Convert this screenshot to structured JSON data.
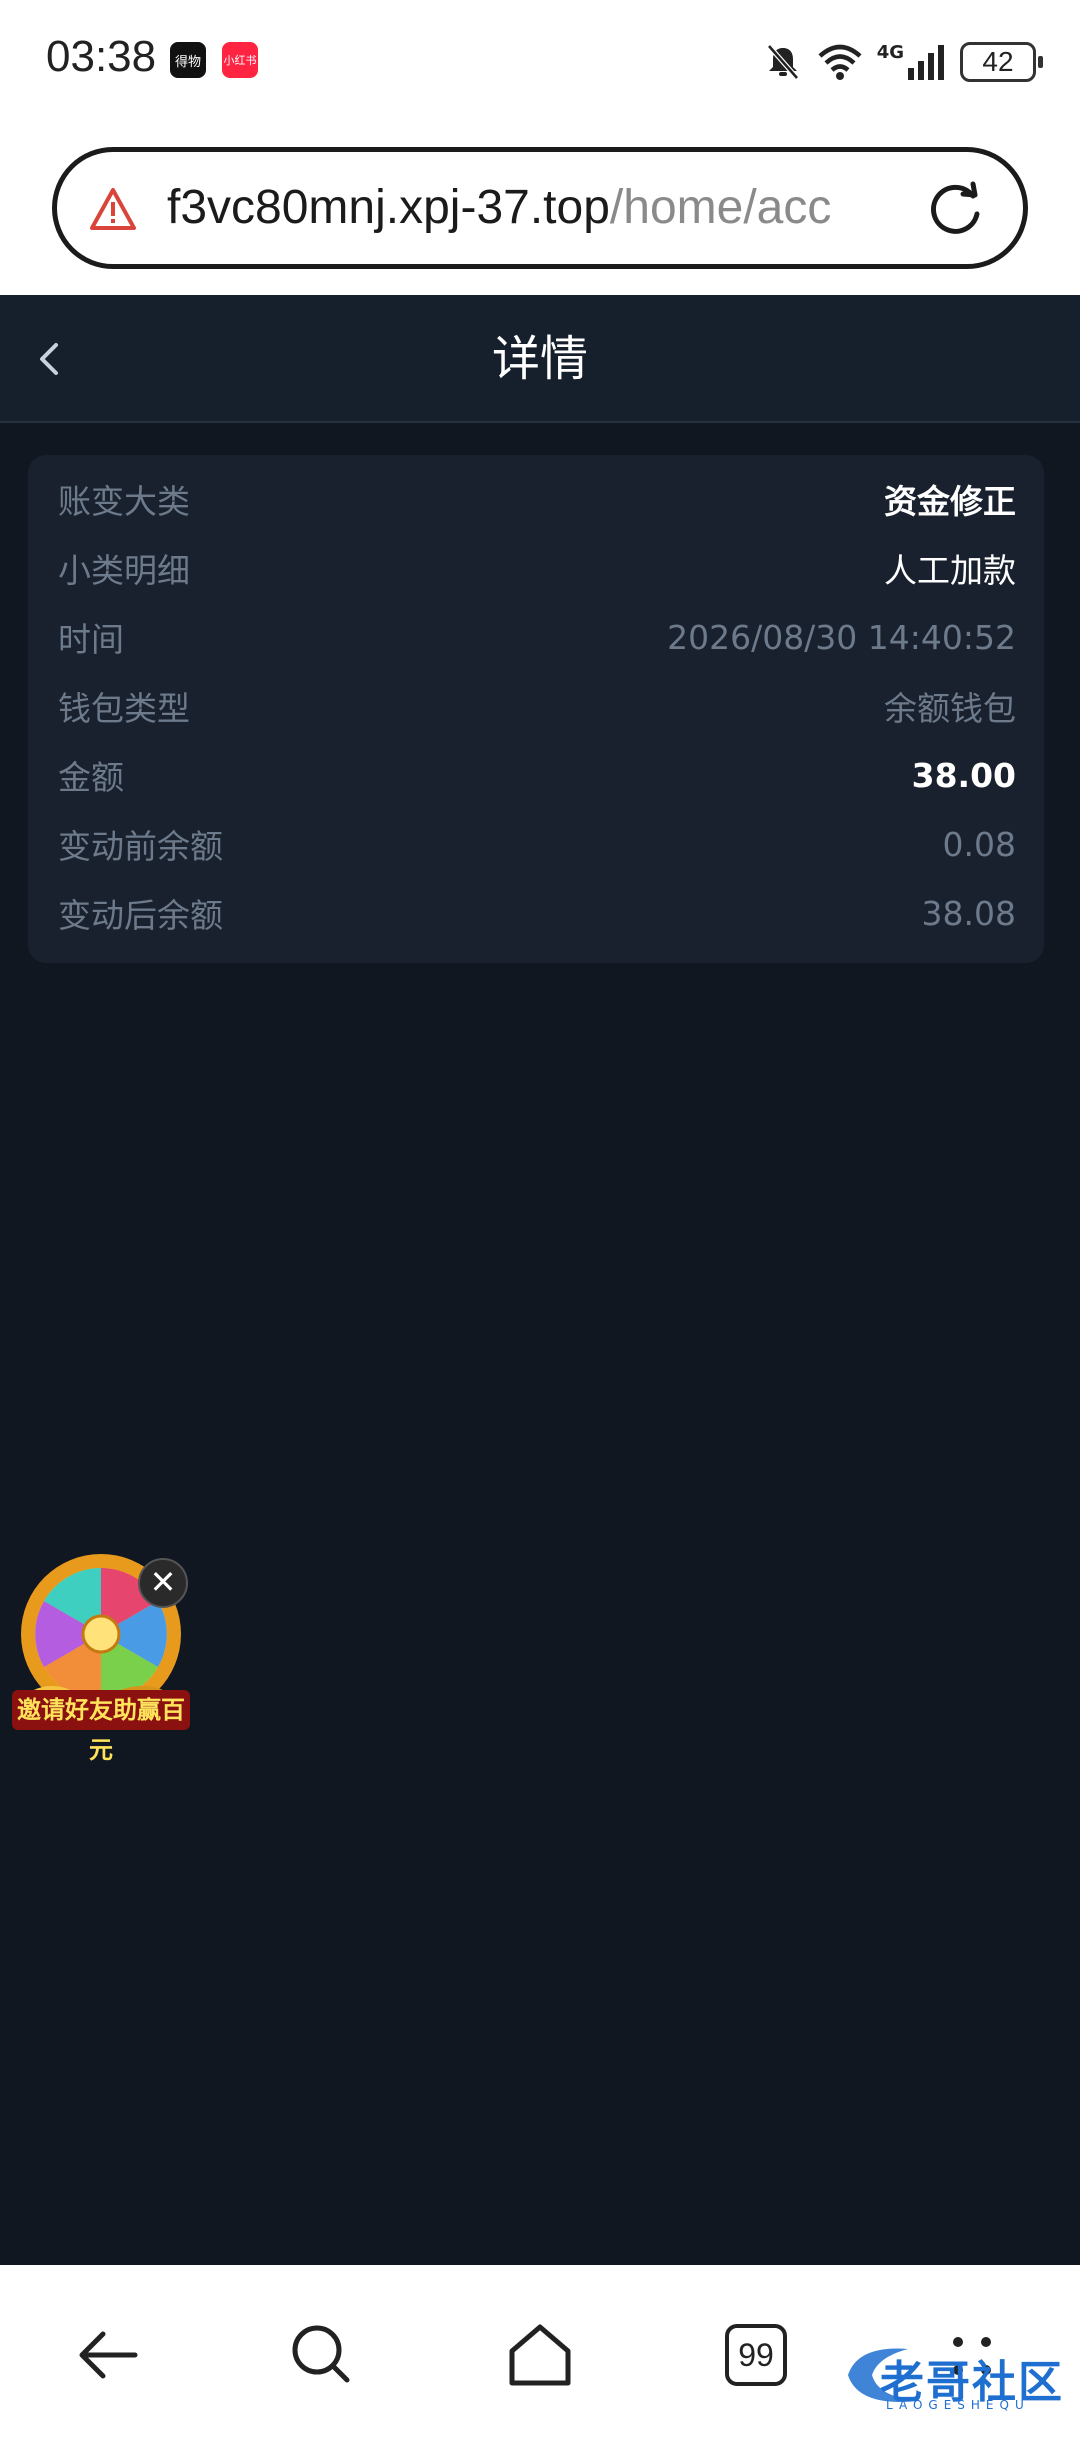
{
  "status_bar": {
    "time": "03:38",
    "app_icon_1": "得物",
    "app_icon_2": "小红书",
    "network": "4G",
    "battery": "42"
  },
  "browser": {
    "url_host": "f3vc80mnj.xpj-37.top",
    "url_path": "/home/acc"
  },
  "nav": {
    "title": "详情"
  },
  "details": [
    {
      "label": "账变大类",
      "value": "资金修正"
    },
    {
      "label": "小类明细",
      "value": "人工加款"
    },
    {
      "label": "时间",
      "value": "2026/08/30 14:40:52"
    },
    {
      "label": "钱包类型",
      "value": "余额钱包"
    },
    {
      "label": "金额",
      "value": "38.00"
    },
    {
      "label": "变动前余额",
      "value": "0.08"
    },
    {
      "label": "变动后余额",
      "value": "38.08"
    }
  ],
  "promo": {
    "text": "邀请好友助赢百元",
    "close": "✕"
  },
  "bottom_bar": {
    "tabs_count": "99"
  },
  "watermark": {
    "text": "老哥社区",
    "sub": "LAOGESHEQU"
  },
  "colors": {
    "page_bg": "#111721",
    "card_bg": "#18212d",
    "muted_text": "#6d7a8b",
    "bright_text": "#ffffff"
  }
}
